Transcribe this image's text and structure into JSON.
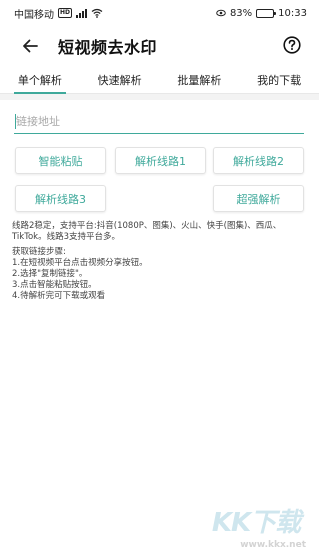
{
  "status_bar": {
    "carrier": "中国移动",
    "network_badge": "HD",
    "battery_text": "83%",
    "battery_level": 0.83,
    "time": "10:33"
  },
  "header": {
    "title": "短视频去水印",
    "back_icon": "arrow-left-icon",
    "help_icon": "question-circle-icon"
  },
  "tabs": [
    {
      "label": "单个解析",
      "active": true
    },
    {
      "label": "快速解析",
      "active": false
    },
    {
      "label": "批量解析",
      "active": false
    },
    {
      "label": "我的下载",
      "active": false
    }
  ],
  "link_input": {
    "placeholder": "链接地址",
    "value": ""
  },
  "buttons": {
    "smart_paste": "智能粘贴",
    "line1": "解析线路1",
    "line2": "解析线路2",
    "line3": "解析线路3",
    "super_parse": "超强解析"
  },
  "info": {
    "routes": "线路2稳定，支持平台:抖音(1080P、图集)、火山、快手(图集)、西瓜、TikTok。线路3支持平台多。",
    "steps_title": "获取链接步骤:",
    "steps": [
      "1.在短视频平台点击视频分享按钮。",
      "2.选择\"复制链接\"。",
      "3.点击智能粘贴按钮。",
      "4.待解析完可下载或观看"
    ]
  },
  "watermark": {
    "logo": "KK下载",
    "url": "www.kkx.net"
  },
  "colors": {
    "accent": "#3fa99b",
    "text": "#333333"
  }
}
